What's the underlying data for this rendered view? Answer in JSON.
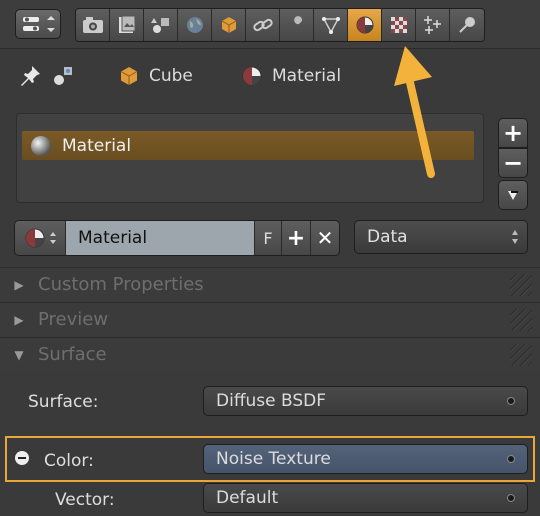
{
  "header": {
    "view_switch_icon": "editor-type-icon",
    "tabs": [
      {
        "name": "render-icon",
        "active": false
      },
      {
        "name": "render-layers-icon",
        "active": false
      },
      {
        "name": "scene-icon",
        "active": false
      },
      {
        "name": "world-icon",
        "active": false
      },
      {
        "name": "object-icon",
        "active": false
      },
      {
        "name": "constraints-icon",
        "active": false
      },
      {
        "name": "modifiers-icon",
        "active": false
      },
      {
        "name": "object-data-icon",
        "active": false
      },
      {
        "name": "material-icon",
        "active": true
      },
      {
        "name": "texture-icon",
        "active": false
      },
      {
        "name": "particles-icon",
        "active": false
      },
      {
        "name": "physics-icon",
        "active": false
      }
    ]
  },
  "context": {
    "object_label": "Cube",
    "material_label": "Material"
  },
  "material_slots": [
    {
      "label": "Material",
      "selected": true
    }
  ],
  "side_buttons": {
    "add": "+",
    "remove": "−",
    "menu": "▾"
  },
  "datablock": {
    "name": "Material",
    "fake_user": "F",
    "new_symbol": "+",
    "unlink_symbol": "✕",
    "link_select": "Data"
  },
  "panels": [
    {
      "title": "Custom Properties",
      "expanded": false
    },
    {
      "title": "Preview",
      "expanded": false
    },
    {
      "title": "Surface",
      "expanded": true
    }
  ],
  "surface": {
    "surface_label": "Surface:",
    "surface_value": "Diffuse BSDF",
    "color_label": "Color:",
    "color_value": "Noise Texture",
    "vector_label": "Vector:",
    "vector_value": "Default"
  },
  "colors": {
    "accent": "#e8a838",
    "selected_row": "#7a5a26",
    "arrow": "#f2b23c",
    "texture_field": "#4a5a72"
  }
}
